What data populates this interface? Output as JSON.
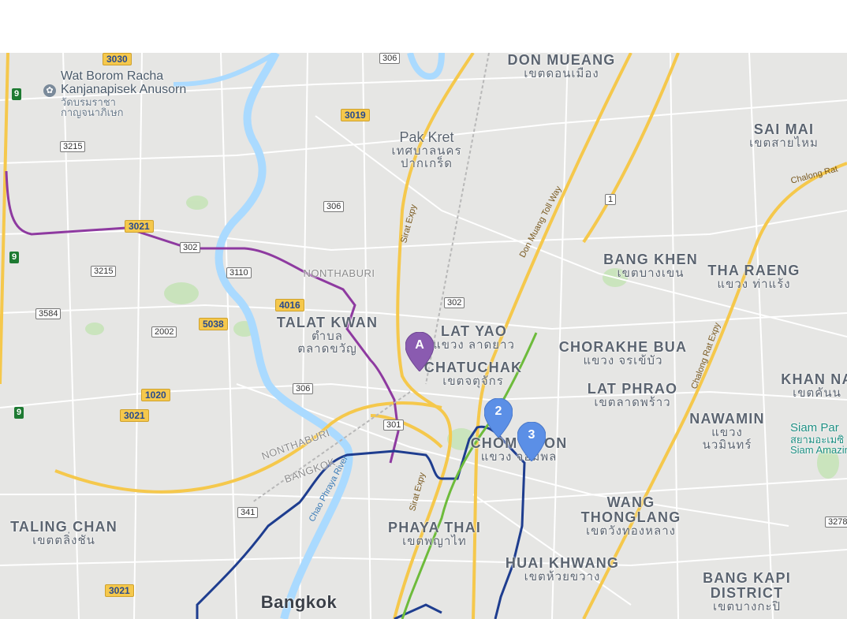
{
  "map": {
    "colors": {
      "background": "#e6e6e4",
      "water": "#aadaff",
      "park": "#c4e3b6",
      "expressway": "#f5c84c",
      "purple_line": "#8e3aa0",
      "blue_line": "#1e3d8f",
      "green_line": "#6dbb3b",
      "marker_a": "#8a5bb0",
      "marker_num": "#5b8fe6"
    },
    "markers": [
      {
        "label": "A"
      },
      {
        "label": "2"
      },
      {
        "label": "3"
      }
    ],
    "districts": {
      "don_mueang": {
        "en": "DON MUEANG",
        "th": "เขตดอนเมือง"
      },
      "sai_mai": {
        "en": "SAI MAI",
        "th": "เขตสายไหม"
      },
      "pak_kret": {
        "en": "Pak Kret",
        "th1": "เทศบาลนคร",
        "th2": "ปากเกร็ด"
      },
      "bang_khen": {
        "en": "BANG KHEN",
        "th": "เขตบางเขน"
      },
      "tha_raeng": {
        "en": "THA RAENG",
        "th": "แขวง ท่าแร้ง"
      },
      "talat_kwan": {
        "en": "TALAT KWAN",
        "th1": "ตำบล",
        "th2": "ตลาดขวัญ"
      },
      "lat_yao": {
        "en": "LAT YAO",
        "th": "แขวง ลาดยาว"
      },
      "chatuchak": {
        "en": "CHATUCHAK",
        "th": "เขตจตุจักร"
      },
      "chorakhe_bua": {
        "en": "CHORAKHE BUA",
        "th": "แขวง จรเข้บัว"
      },
      "lat_phrao": {
        "en": "LAT PHRAO",
        "th": "เขตลาดพร้าว"
      },
      "khan_na": {
        "en": "KHAN NA",
        "th": "เขตคันน"
      },
      "nawamin": {
        "en": "NAWAMIN",
        "th1": "แขวง",
        "th2": "นวมินทร์"
      },
      "chom_phon": {
        "en": "CHOM PHON",
        "th": "แขวง จอมพล"
      },
      "wang_thonglang": {
        "en1": "WANG",
        "en2": "THONGLANG",
        "th": "เขตวังทองหลาง"
      },
      "phaya_thai": {
        "en": "PHAYA THAI",
        "th": "เขตพญาไท"
      },
      "huai_khwang": {
        "en": "HUAI KHWANG",
        "th": "เขตห้วยขวาง"
      },
      "bang_kapi": {
        "en1": "BANG KAPI",
        "en2": "DISTRICT",
        "th": "เขตบางกะปิ"
      },
      "taling_chan": {
        "en": "TALING CHAN",
        "th": "เขตตลิ่งชัน"
      },
      "bangkok": {
        "en": "Bangkok"
      },
      "nonthaburi_top": {
        "en": "NONTHABURI"
      },
      "nonthaburi_low": {
        "en": "NONTHABURI"
      },
      "bangkok_small": {
        "en": "BANGKOK"
      }
    },
    "pois": {
      "wat": {
        "en1": "Wat Borom Racha",
        "en2": "Kanjanapisek Anusorn",
        "th1": "วัดบรมราชา",
        "th2": "กาญจนาภิเษก"
      },
      "siam_park": {
        "en": "Siam Par",
        "th": "สยามอะเมซิ",
        "en2": "Siam Amazin"
      }
    },
    "roads": {
      "sirat_expy_1": "Sirat Expy",
      "sirat_expy_2": "Sirat Expy",
      "don_muang_tollway": "Don Muang Toll Way",
      "chalong_rat_1": "Chalong Rat Expy",
      "chalong_rat_2": "Chalong Rat",
      "chao_phraya": "Chao Phraya River"
    },
    "shields_yellow": [
      "3030",
      "3019",
      "3021",
      "4016",
      "5038",
      "1020",
      "3021",
      "3021"
    ],
    "shields_white": [
      "306",
      "3215",
      "306",
      "302",
      "3215",
      "3110",
      "3584",
      "2002",
      "302",
      "306",
      "301",
      "341",
      "3278",
      "1"
    ],
    "shields_green": [
      "9",
      "9",
      "9"
    ]
  }
}
